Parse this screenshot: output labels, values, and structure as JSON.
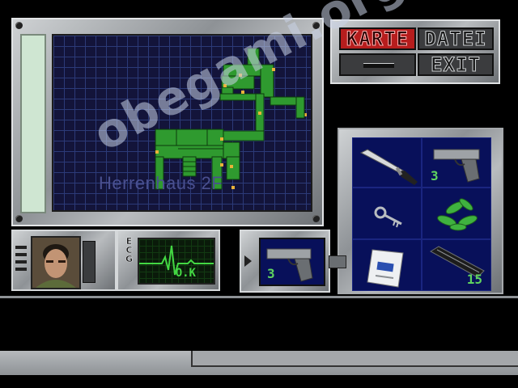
{
  "menu": {
    "map_label": "KARTE",
    "files_label": "DATEI",
    "exit_label": "EXIT"
  },
  "map": {
    "location": "Herrenhaus 2F"
  },
  "status": {
    "health_label": "ECG",
    "condition": "O.K"
  },
  "equipped": {
    "icon": "handgun-icon",
    "quantity": "3"
  },
  "inventory": [
    {
      "icon": "combat-knife-icon",
      "quantity": ""
    },
    {
      "icon": "handgun-icon",
      "quantity": "3"
    },
    {
      "icon": "key-icon",
      "quantity": ""
    },
    {
      "icon": "green-herb-icon",
      "quantity": ""
    },
    {
      "icon": "first-aid-spray-icon",
      "quantity": ""
    },
    {
      "icon": "lighter-icon",
      "quantity": "15"
    }
  ],
  "watermark": "obegami.org",
  "colors": {
    "map_background": "#13143a",
    "map_grid": "#2c3a78",
    "explored_room": "#2f9a2f",
    "door_marker": "#e9b23a",
    "inventory_background": "#08105a",
    "quantity_text": "#5fd35f",
    "active_menu": "#b61d1d"
  }
}
